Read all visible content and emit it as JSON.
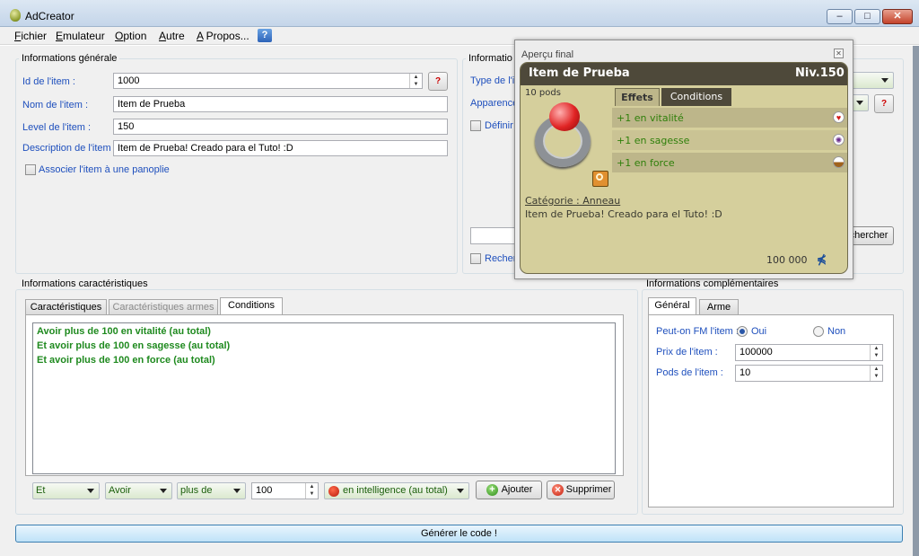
{
  "window": {
    "title": "AdCreator",
    "minimize": "–",
    "maximize": "□",
    "close": "✕"
  },
  "menu": {
    "items": [
      {
        "first": "F",
        "rest": "ichier"
      },
      {
        "first": "E",
        "rest": "mulateur"
      },
      {
        "first": "O",
        "rest": "ption"
      },
      {
        "first": "A",
        "rest": "utre"
      },
      {
        "first": "A",
        "rest": " Propos..."
      }
    ],
    "help_glyph": "?"
  },
  "general": {
    "title": "Informations générale",
    "id_label": "Id de l'item :",
    "id_value": "1000",
    "help_glyph": "?",
    "name_label": "Nom de l'item :",
    "name_value": "Item de Prueba",
    "level_label": "Level de l'item :",
    "level_value": "150",
    "desc_label": "Description de l'item :",
    "desc_value": "Item de Prueba! Creado para el Tuto! :D",
    "panoply_label": "Associer l'item à une panoplie"
  },
  "info_right": {
    "title": "Informatio",
    "type_label": "Type de l'ite",
    "appearance_label": "Apparence",
    "define_label": "Définir",
    "search_button": "chercher",
    "search_label": "Recher",
    "help_glyph": "?"
  },
  "characteristics": {
    "title": "Informations caractéristiques",
    "tabs": [
      "Caractéristiques",
      "Caractéristiques armes",
      "Conditions"
    ],
    "conditions": [
      "Avoir plus de 100 en vitalité (au total)",
      "Et avoir plus de 100 en sagesse (au total)",
      "Et avoir plus de 100 en force (au total)"
    ],
    "combo_and": "Et",
    "combo_have": "Avoir",
    "combo_more": "plus de",
    "amount": "100",
    "stat": "en intelligence (au total)",
    "add_button": "Ajouter",
    "delete_button": "Supprimer"
  },
  "complementary": {
    "title": "Informations complémentaires",
    "tabs": [
      "Général",
      "Arme"
    ],
    "fm_label": "Peut-on FM l'item :",
    "yes": "Oui",
    "no": "Non",
    "fm_selected": "Oui",
    "price_label": "Prix de l'item :",
    "price_value": "100000",
    "pods_label": "Pods de l'item :",
    "pods_value": "10"
  },
  "generate_button": "Générer le code !",
  "preview": {
    "title": "Aperçu final",
    "close_glyph": "✕",
    "item_name": "Item de Prueba",
    "level": "Niv.150",
    "pods": "10 pods",
    "tabs": [
      "Effets",
      "Conditions"
    ],
    "effects": [
      {
        "text": "+1 en vitalité",
        "icon": "heart-icon"
      },
      {
        "text": "+1 en sagesse",
        "icon": "wisdom-icon"
      },
      {
        "text": "+1 en force",
        "icon": "strength-icon"
      }
    ],
    "category": "Catégorie : Anneau",
    "description": "Item de Prueba! Creado para el Tuto! :D",
    "price": "100 000",
    "colors": {
      "header": "#4e493a",
      "card": "#d5cf9c",
      "effect_text": "#2f7f0a"
    }
  }
}
